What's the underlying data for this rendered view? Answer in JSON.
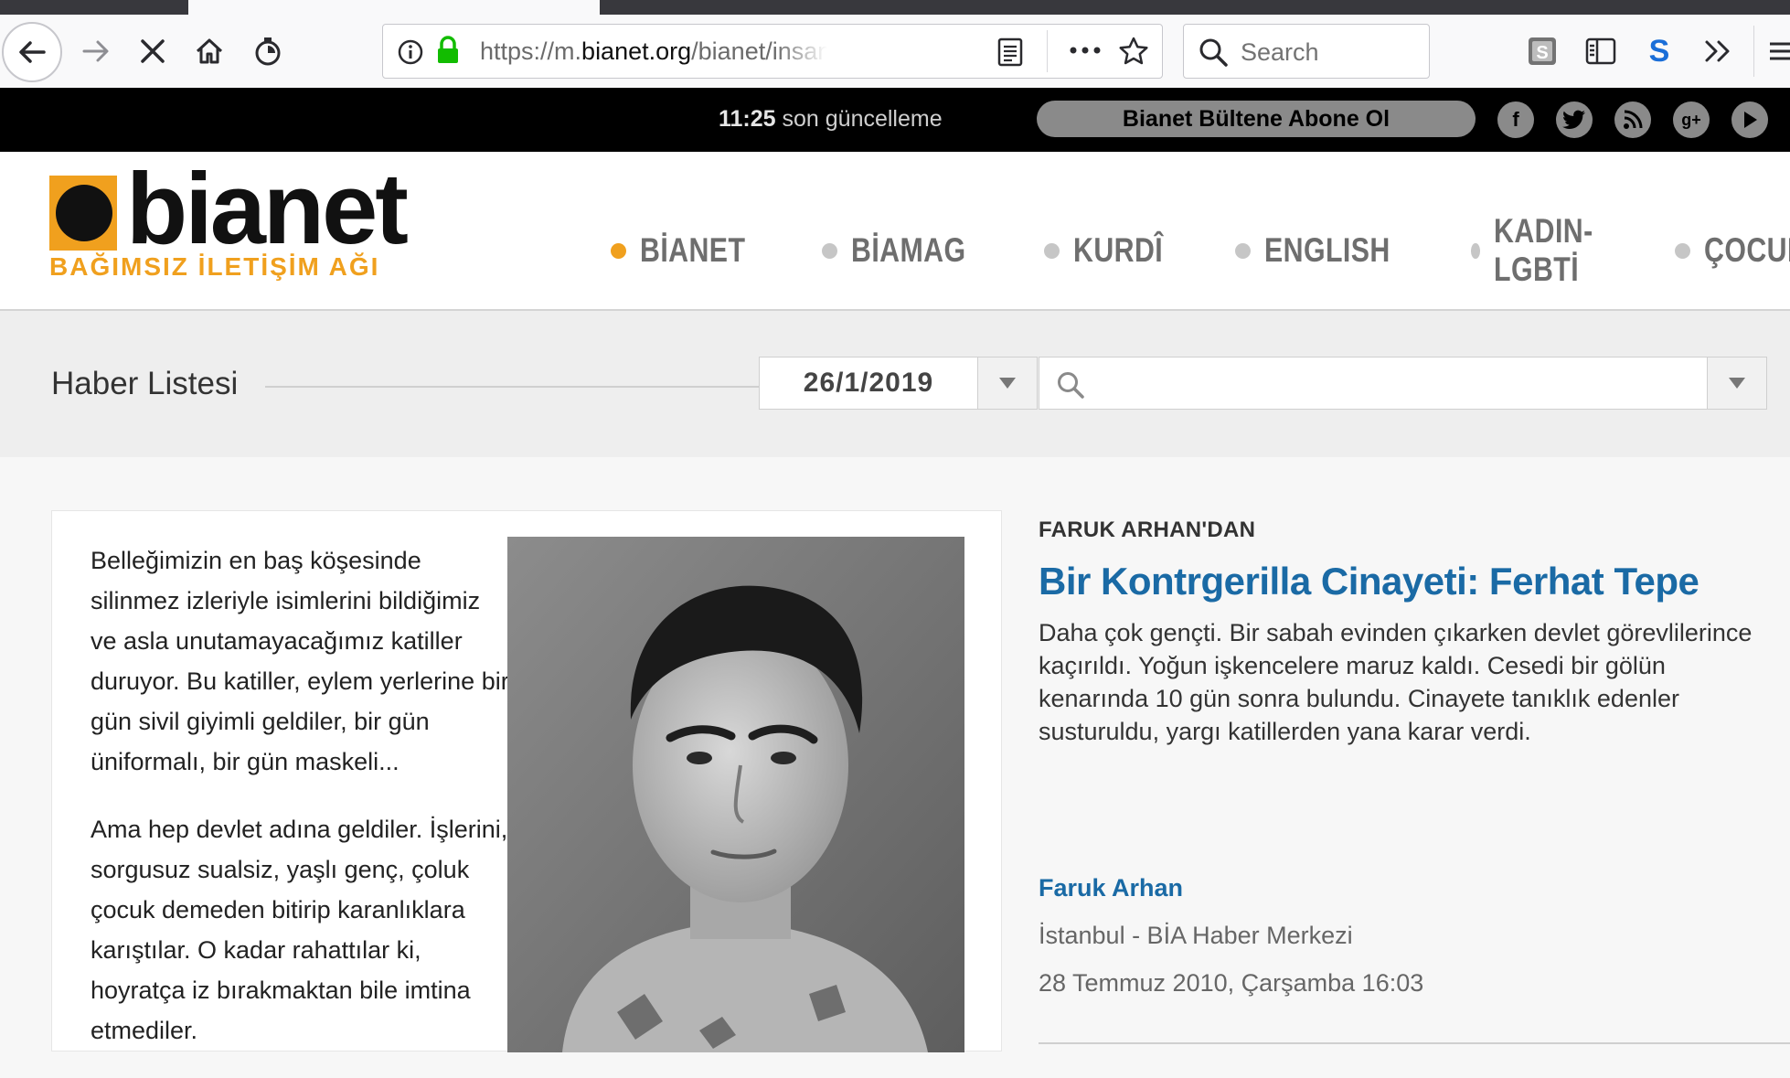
{
  "browser": {
    "url_scheme": "https://m.",
    "url_host": "bianet.org",
    "url_path": "/bianet/insan-hakla",
    "search_placeholder": "Search"
  },
  "topbar": {
    "update_time": "11:25",
    "update_suffix": " son güncelleme",
    "subscribe_label": "Bianet Bültene Abone Ol",
    "social": [
      "facebook-icon",
      "twitter-icon",
      "rss-icon",
      "google-plus-icon",
      "youtube-icon"
    ]
  },
  "logo": {
    "word": "bianet",
    "tagline": "BAĞIMSIZ İLETİŞİM AĞI"
  },
  "nav": [
    {
      "label": "BİANET",
      "active": true
    },
    {
      "label": "BİAMAG",
      "active": false
    },
    {
      "label": "KURDÎ",
      "active": false
    },
    {
      "label": "ENGLISH",
      "active": false
    },
    {
      "label": "KADIN-LGBTİ",
      "active": false
    },
    {
      "label": "ÇOCUK",
      "active": false
    }
  ],
  "filter": {
    "title": "Haber Listesi",
    "date": "26/1/2019"
  },
  "article": {
    "para1": "Belleğimizin en baş köşesinde silinmez izleriyle isimlerini bildiğimiz ve asla unutamayacağımız katiller duruyor. Bu katiller, eylem yerlerine bir gün sivil giyimli geldiler, bir gün üniformalı, bir gün maskeli...",
    "para2": "Ama hep devlet adına geldiler. İşlerini, sorgusuz sualsiz, yaşlı genç, çoluk çocuk demeden bitirip karanlıklara karıştılar. O kadar rahattılar ki, hoyratça iz bırakmaktan bile imtina etmediler.",
    "kicker": "FARUK ARHAN'DAN",
    "headline": "Bir Kontrgerilla Cinayeti: Ferhat Tepe",
    "summary": "Daha çok gençti. Bir sabah evinden çıkarken devlet görevlilerince kaçırıldı. Yoğun işkencelere maruz kaldı. Cesedi bir gölün kenarında 10 gün sonra bulundu. Cinayete tanıklık edenler susturuldu, yargı katillerden yana karar verdi.",
    "author": "Faruk Arhan",
    "place": "İstanbul - BİA Haber Merkezi",
    "date": "28 Temmuz 2010, Çarşamba 16:03"
  },
  "colors": {
    "accent_orange": "#f0a01e",
    "link_blue": "#1a6aa5"
  }
}
